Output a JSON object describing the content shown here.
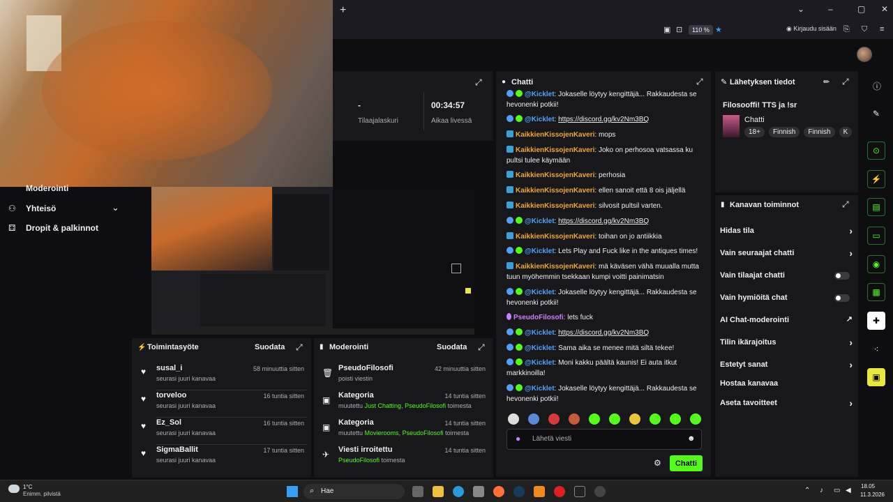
{
  "browser": {
    "zoom": "110 %",
    "login": "Kirjaudu sisään"
  },
  "left_nav": {
    "item_moderation": "Moderointi",
    "item_community": "Yhteisö",
    "item_drops": "Dropit & palkinnot"
  },
  "stats": {
    "subs_value": "-",
    "subs_label": "Tilaajalaskuri",
    "time_value": "00:34:57",
    "time_label": "Aikaa livessä"
  },
  "activity": {
    "title": "Toimintasyöte",
    "filter": "Suodata",
    "items": [
      {
        "name": "susal_i",
        "sub": "seurasi juuri kanavaa",
        "time": "58 minuuttia sitten"
      },
      {
        "name": "torveloo",
        "sub": "seurasi juuri kanavaa",
        "time": "16 tuntia sitten"
      },
      {
        "name": "Ez_Sol",
        "sub": "seurasi juuri kanavaa",
        "time": "16 tuntia sitten"
      },
      {
        "name": "SigmaBallit",
        "sub": "seurasi juuri kanavaa",
        "time": "17 tuntia sitten"
      }
    ]
  },
  "moderation": {
    "title": "Moderointi",
    "filter": "Suodata",
    "items": [
      {
        "name": "PseudoFilosofi",
        "sub": "poisti viestin",
        "time": "42 minuuttia sitten",
        "pre": "",
        "g1": "",
        "mid": "",
        "g2": "",
        "post": ""
      },
      {
        "name": "Kategoria",
        "time": "14 tuntia sitten",
        "pre": "muutettu ",
        "g1": "Just Chatting",
        "mid": ", ",
        "g2": "PseudoFilosofi",
        "post": " toimesta"
      },
      {
        "name": "Kategoria",
        "time": "14 tuntia sitten",
        "pre": "muutettu ",
        "g1": "Movierooms",
        "mid": ", ",
        "g2": "PseudoFilosofi",
        "post": " toimesta"
      },
      {
        "name": "Viesti irroitettu",
        "time": "14 tuntia sitten",
        "pre": "",
        "g1": "",
        "mid": "",
        "g2": "PseudoFilosofi",
        "post": " toimesta"
      }
    ]
  },
  "chat": {
    "title": "Chatti",
    "input_placeholder": "Lähetä viesti",
    "send": "Chatti",
    "messages": [
      {
        "user": "@Kicklet",
        "text": ": Jokaselle löytyy kengittäjä... Rakkaudesta se hevonenki potkii!"
      },
      {
        "user": "@Kicklet",
        "text": ": ",
        "link": "https://discord.gg/kv2Nm3BQ"
      },
      {
        "user": "KaikkienKissojenKaveri",
        "text": ": mops"
      },
      {
        "user": "KaikkienKissojenKaveri",
        "text": ": Joko on perhosoa vatsassa ku pultsi tulee käymään"
      },
      {
        "user": "KaikkienKissojenKaveri",
        "text": ": perhosia"
      },
      {
        "user": "KaikkienKissojenKaveri",
        "text": ": ellen sanoit että 8 ois jäljellä"
      },
      {
        "user": "KaikkienKissojenKaveri",
        "text": ": silvosit pultsil varten."
      },
      {
        "user": "@Kicklet",
        "text": ": ",
        "link": "https://discord.gg/kv2Nm3BQ"
      },
      {
        "user": "KaikkienKissojenKaveri",
        "text": ": toihan on jo antiikkia"
      },
      {
        "user": "@Kicklet",
        "text": ": Lets Play and Fuck like in the antiques times!"
      },
      {
        "user": "KaikkienKissojenKaveri",
        "text": ": mä käväsen vähä muualla mutta tuun myöhemmin tsekkaan kumpi voitti painimatsin"
      },
      {
        "user": "@Kicklet",
        "text": ": Jokaselle löytyy kengittäjä... Rakkaudesta se hevonenki potkii!"
      },
      {
        "user": "PseudoFilosofi",
        "text": ": lets fuck"
      },
      {
        "user": "@Kicklet",
        "text": ": ",
        "link": "https://discord.gg/kv2Nm3BQ"
      },
      {
        "user": "@Kicklet",
        "text": ": Sama aika se menee mitä siltä tekee!"
      },
      {
        "user": "@Kicklet",
        "text": ": Moni kakku päältä kaunis! Ei auta itkut markkinoilla!"
      },
      {
        "user": "@Kicklet",
        "text": ": Jokaselle löytyy kengittäjä... Rakkaudesta se hevonenki potkii!"
      }
    ]
  },
  "stream_info": {
    "title": "Lähetyksen tiedot",
    "stream_title": "Filosooffi! TTS ja !sr",
    "category": "Chatti",
    "tags": [
      "18+",
      "Finnish",
      "Finnish",
      "K"
    ]
  },
  "channel_actions": {
    "title": "Kanavan toiminnot",
    "items": [
      {
        "label": "Hidas tila",
        "control": "arrow"
      },
      {
        "label": "Vain seuraajat chatti",
        "control": "arrow"
      },
      {
        "label": "Vain tilaajat chatti",
        "control": "toggle"
      },
      {
        "label": "Vain hymiöitä chat",
        "control": "toggle"
      },
      {
        "label": "AI Chat-moderointi",
        "control": "external"
      },
      {
        "label": "Tilin ikärajoitus",
        "control": "arrow"
      },
      {
        "label": "Estetyt sanat",
        "control": "arrow"
      },
      {
        "label": "Hostaa kanavaa",
        "control": "none"
      },
      {
        "label": "Aseta tavoitteet",
        "control": "arrow"
      }
    ]
  },
  "taskbar": {
    "weather_temp": "1°C",
    "weather_desc": "Enimm. pilvistä",
    "search": "Hae",
    "time": "18.05",
    "date": "11.3.2026"
  },
  "colors": {
    "accent": "#53fc18",
    "bg": "#0e0e10",
    "panel": "#18181b"
  }
}
